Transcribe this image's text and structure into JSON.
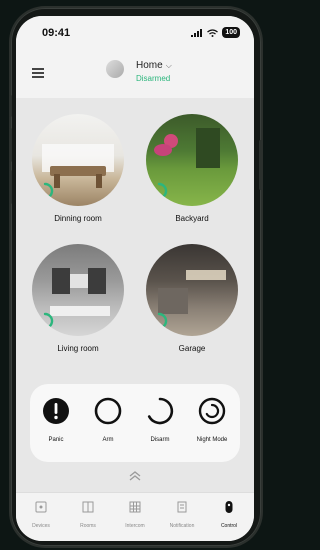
{
  "status_bar": {
    "time": "09:41",
    "battery": "100"
  },
  "header": {
    "title": "Home",
    "status": "Disarmed"
  },
  "rooms": [
    {
      "label": "Dinning room",
      "icon": "dining-room-photo"
    },
    {
      "label": "Backyard",
      "icon": "backyard-photo"
    },
    {
      "label": "Living room",
      "icon": "living-room-photo"
    },
    {
      "label": "Garage",
      "icon": "garage-photo"
    }
  ],
  "controls": [
    {
      "label": "Panic",
      "icon": "panic-icon"
    },
    {
      "label": "Arm",
      "icon": "arm-icon"
    },
    {
      "label": "Disarm",
      "icon": "disarm-icon"
    },
    {
      "label": "Night Mode",
      "icon": "night-mode-icon"
    }
  ],
  "nav": [
    {
      "label": "Devices",
      "icon": "devices-icon"
    },
    {
      "label": "Rooms",
      "icon": "rooms-icon"
    },
    {
      "label": "Intercom",
      "icon": "intercom-icon"
    },
    {
      "label": "Notification",
      "icon": "notification-icon"
    },
    {
      "label": "Control",
      "icon": "control-icon",
      "active": true
    }
  ],
  "colors": {
    "accent": "#2cb67d",
    "background": "#e7e7e7"
  }
}
